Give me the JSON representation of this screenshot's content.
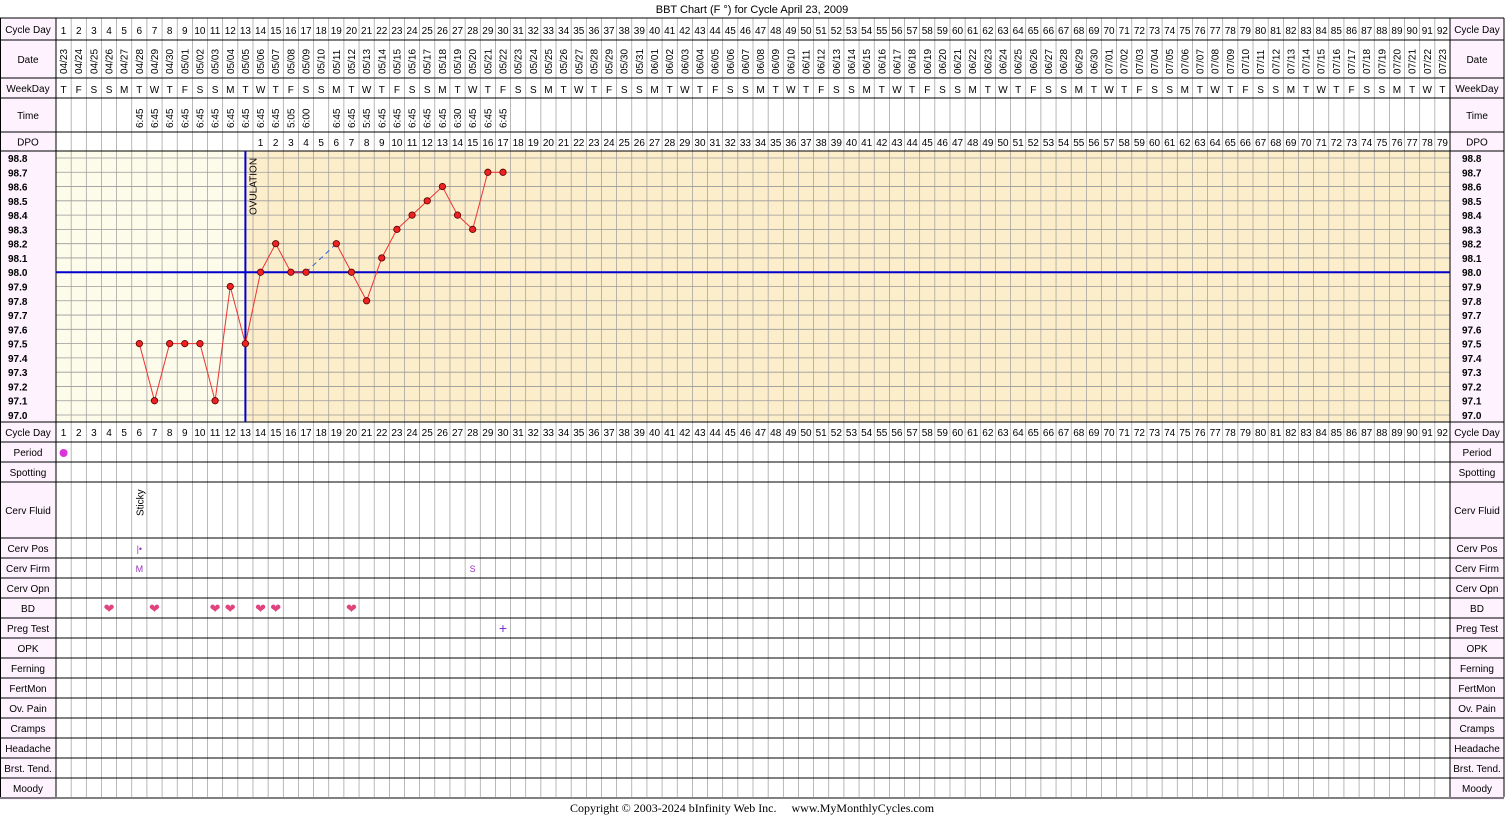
{
  "title": "BBT Chart (F °) for Cycle April 23, 2009",
  "copyright": "Copyright © 2003-2024 bInfinity Web Inc.     www.MyMonthlyCycles.com",
  "colors": {
    "border": "#000000",
    "grid": "#9a9a9a",
    "pre_ovulation_bg": "#fdfbe9",
    "post_ovulation_bg": "#fdeecb",
    "label_bg": "#fdf2fd",
    "temp_line": "#ee3333",
    "dot_fill": "#ee2222",
    "coverline": "#0000cc",
    "ovulation_line": "#0000cc",
    "period": "#dd33dd",
    "heart": "#e0447f",
    "cervix": "#9933bb",
    "preg_test": "#7733cc"
  },
  "labels": {
    "cycle_day": "Cycle Day",
    "date": "Date",
    "weekday": "WeekDay",
    "time": "Time",
    "dpo": "DPO",
    "ovulation": "OVULATION"
  },
  "cycle_days": [
    "1",
    "2",
    "3",
    "4",
    "5",
    "6",
    "7",
    "8",
    "9",
    "10",
    "11",
    "12",
    "13",
    "14",
    "15",
    "16",
    "17",
    "18",
    "19",
    "20",
    "21",
    "22",
    "23",
    "24",
    "25",
    "26",
    "27",
    "28",
    "29",
    "30",
    "31",
    "32",
    "33",
    "34",
    "35",
    "36",
    "37",
    "38",
    "39",
    "40",
    "41",
    "42",
    "43",
    "44",
    "45",
    "46",
    "47",
    "48",
    "49",
    "50",
    "51",
    "52",
    "53",
    "54",
    "55",
    "56",
    "57",
    "58",
    "59",
    "60",
    "61",
    "62",
    "63",
    "64",
    "65",
    "66",
    "67",
    "68",
    "69",
    "70",
    "71",
    "72",
    "73",
    "74",
    "75",
    "76",
    "77",
    "78",
    "79",
    "80",
    "81",
    "82",
    "83",
    "84",
    "85",
    "86",
    "87",
    "88",
    "89",
    "90",
    "91",
    "92"
  ],
  "dates": [
    "04/23",
    "04/24",
    "04/25",
    "04/26",
    "04/27",
    "04/28",
    "04/29",
    "04/30",
    "05/01",
    "05/02",
    "05/03",
    "05/04",
    "05/05",
    "05/06",
    "05/07",
    "05/08",
    "05/09",
    "05/10",
    "05/11",
    "05/12",
    "05/13",
    "05/14",
    "05/15",
    "05/16",
    "05/17",
    "05/18",
    "05/19",
    "05/20",
    "05/21",
    "05/22",
    "05/23",
    "05/24",
    "05/25",
    "05/26",
    "05/27",
    "05/28",
    "05/29",
    "05/30",
    "05/31",
    "06/01",
    "06/02",
    "06/03",
    "06/04",
    "06/05",
    "06/06",
    "06/07",
    "06/08",
    "06/09",
    "06/10",
    "06/11",
    "06/12",
    "06/13",
    "06/14",
    "06/15",
    "06/16",
    "06/17",
    "06/18",
    "06/19",
    "06/20",
    "06/21",
    "06/22",
    "06/23",
    "06/24",
    "06/25",
    "06/26",
    "06/27",
    "06/28",
    "06/29",
    "06/30",
    "07/01",
    "07/02",
    "07/03",
    "07/04",
    "07/05",
    "07/06",
    "07/07",
    "07/08",
    "07/09",
    "07/10",
    "07/11",
    "07/12",
    "07/13",
    "07/14",
    "07/15",
    "07/16",
    "07/17",
    "07/18",
    "07/19",
    "07/20",
    "07/21",
    "07/22",
    "07/23"
  ],
  "weekdays": [
    "T",
    "F",
    "S",
    "S",
    "M",
    "T",
    "W",
    "T",
    "F",
    "S",
    "S",
    "M",
    "T",
    "W",
    "T",
    "F",
    "S",
    "S",
    "M",
    "T",
    "W",
    "T",
    "F",
    "S",
    "S",
    "M",
    "T",
    "W",
    "T",
    "F",
    "S",
    "S",
    "M",
    "T",
    "W",
    "T",
    "F",
    "S",
    "S",
    "M",
    "T",
    "W",
    "T",
    "F",
    "S",
    "S",
    "M",
    "T",
    "W",
    "T",
    "F",
    "S",
    "S",
    "M",
    "T",
    "W",
    "T",
    "F",
    "S",
    "S",
    "M",
    "T",
    "W",
    "T",
    "F",
    "S",
    "S",
    "M",
    "T",
    "W",
    "T",
    "F",
    "S",
    "S",
    "M",
    "T",
    "W",
    "T",
    "F",
    "S",
    "S",
    "M",
    "T",
    "W",
    "T",
    "F",
    "S",
    "S",
    "M",
    "T",
    "W",
    "T"
  ],
  "times": [
    "",
    "",
    "",
    "",
    "",
    "6:45",
    "6:45",
    "6:45",
    "6:45",
    "6:45",
    "6:45",
    "6:45",
    "6:45",
    "6:45",
    "6:45",
    "5:05",
    "6:00",
    "",
    "6:45",
    "6:45",
    "5:45",
    "6:45",
    "6:45",
    "6:45",
    "6:45",
    "6:45",
    "6:30",
    "6:45",
    "6:45",
    "6:45",
    "",
    "",
    "",
    "",
    "",
    "",
    "",
    "",
    "",
    "",
    "",
    "",
    "",
    "",
    "",
    "",
    "",
    "",
    "",
    "",
    "",
    "",
    "",
    "",
    "",
    "",
    "",
    "",
    "",
    "",
    "",
    "",
    "",
    "",
    "",
    "",
    "",
    "",
    "",
    "",
    "",
    "",
    "",
    "",
    "",
    "",
    "",
    "",
    "",
    "",
    "",
    "",
    "",
    "",
    "",
    "",
    "",
    "",
    "",
    "",
    "",
    "",
    "",
    ""
  ],
  "dpo": [
    "",
    "",
    "",
    "",
    "",
    "",
    "",
    "",
    "",
    "",
    "",
    "",
    "",
    "1",
    "2",
    "3",
    "4",
    "5",
    "6",
    "7",
    "8",
    "9",
    "10",
    "11",
    "12",
    "13",
    "14",
    "15",
    "16",
    "17",
    "18",
    "19",
    "20",
    "21",
    "22",
    "23",
    "24",
    "25",
    "26",
    "27",
    "28",
    "29",
    "30",
    "31",
    "32",
    "33",
    "34",
    "35",
    "36",
    "37",
    "38",
    "39",
    "40",
    "41",
    "42",
    "43",
    "44",
    "45",
    "46",
    "47",
    "48",
    "49",
    "50",
    "51",
    "52",
    "53",
    "54",
    "55",
    "56",
    "57",
    "58",
    "59",
    "60",
    "61",
    "62",
    "63",
    "64",
    "65",
    "66",
    "67",
    "68",
    "69",
    "70",
    "71",
    "72",
    "73",
    "74",
    "75",
    "76",
    "77",
    "78",
    "79"
  ],
  "temp_ticks": [
    "98.8",
    "98.7",
    "98.6",
    "98.5",
    "98.4",
    "98.3",
    "98.2",
    "98.1",
    "98.0",
    "97.9",
    "97.8",
    "97.7",
    "97.6",
    "97.5",
    "97.4",
    "97.3",
    "97.2",
    "97.1",
    "97.0"
  ],
  "chart_data": {
    "type": "line",
    "title": "BBT Chart (F °) for Cycle April 23, 2009",
    "xlabel": "Cycle Day",
    "ylabel": "",
    "ylim": [
      97.0,
      98.8
    ],
    "y_step": 0.1,
    "x_range": [
      1,
      92
    ],
    "grid": true,
    "coverline": 98.0,
    "ovulation_cycle_day": 13,
    "series": [
      {
        "x": [
          6,
          7,
          8,
          9,
          10,
          11,
          12,
          13,
          14,
          15,
          16,
          17,
          19,
          20,
          21,
          22,
          23,
          24,
          25,
          26,
          27,
          28,
          29,
          30
        ],
        "y": [
          97.5,
          97.1,
          97.5,
          97.5,
          97.5,
          97.1,
          97.9,
          97.5,
          98.0,
          98.2,
          98.0,
          98.0,
          98.2,
          98.0,
          97.8,
          98.1,
          98.3,
          98.4,
          98.5,
          98.6,
          98.4,
          98.3,
          98.7,
          98.7
        ]
      }
    ],
    "skipped_days": [
      18
    ]
  },
  "symptom_rows": [
    {
      "label": "Period",
      "marks": [
        {
          "day": 1,
          "type": "dot"
        }
      ]
    },
    {
      "label": "Spotting",
      "marks": []
    },
    {
      "label": "Cerv Fluid",
      "marks": [
        {
          "day": 6,
          "type": "vtext",
          "text": "Sticky"
        }
      ]
    },
    {
      "label": "Cerv Pos",
      "marks": [
        {
          "day": 6,
          "type": "text",
          "text": "|•"
        }
      ]
    },
    {
      "label": "Cerv Firm",
      "marks": [
        {
          "day": 6,
          "type": "text",
          "text": "M"
        },
        {
          "day": 28,
          "type": "text",
          "text": "S"
        }
      ]
    },
    {
      "label": "Cerv Opn",
      "marks": []
    },
    {
      "label": "BD",
      "marks": [
        {
          "day": 4,
          "type": "heart"
        },
        {
          "day": 7,
          "type": "heart"
        },
        {
          "day": 11,
          "type": "heart"
        },
        {
          "day": 12,
          "type": "heart"
        },
        {
          "day": 14,
          "type": "heart"
        },
        {
          "day": 15,
          "type": "heart"
        },
        {
          "day": 20,
          "type": "heart"
        }
      ]
    },
    {
      "label": "Preg Test",
      "marks": [
        {
          "day": 30,
          "type": "plus"
        }
      ]
    },
    {
      "label": "OPK",
      "marks": []
    },
    {
      "label": "Ferning",
      "marks": []
    },
    {
      "label": "FertMon",
      "marks": []
    },
    {
      "label": "Ov. Pain",
      "marks": []
    },
    {
      "label": "Cramps",
      "marks": []
    },
    {
      "label": "Headache",
      "marks": []
    },
    {
      "label": "Brst. Tend.",
      "marks": []
    },
    {
      "label": "Moody",
      "marks": []
    }
  ]
}
